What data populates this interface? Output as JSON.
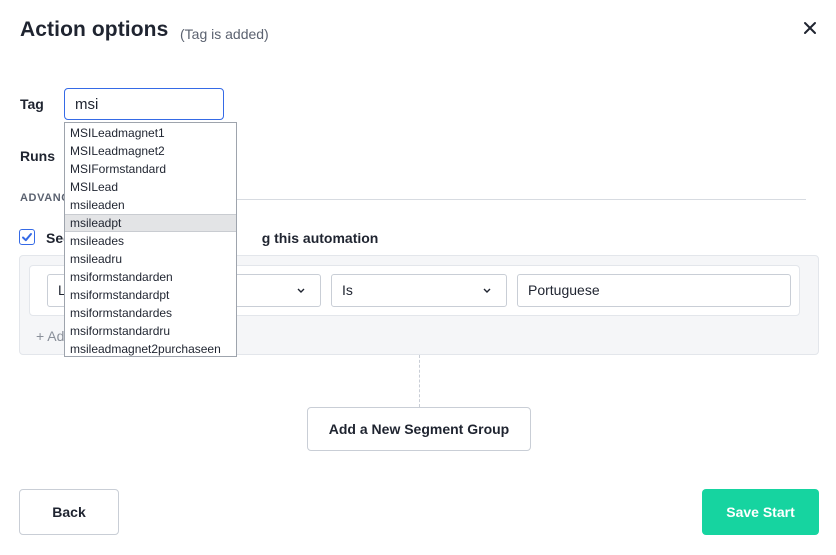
{
  "modal": {
    "title": "Action options",
    "subtitle": "(Tag is added)",
    "close_icon": "close-icon"
  },
  "tag": {
    "label": "Tag",
    "value": "msi"
  },
  "runs": {
    "label": "Runs"
  },
  "advanced": {
    "label": "ADVANC",
    "segment_checkbox_checked": true,
    "segment_label_start": "Seg",
    "segment_label_end": "g this automation"
  },
  "segment": {
    "field_value": "L",
    "operator_value": "Is",
    "condition_value": "Portuguese",
    "add_condition_label": "+ Ad"
  },
  "buttons": {
    "add_segment_group": "Add a New Segment Group",
    "back": "Back",
    "save_start": "Save Start"
  },
  "dropdown": {
    "highlighted_index": 5,
    "items": [
      "MSILeadmagnet1",
      "MSILeadmagnet2",
      "MSIFormstandard",
      "MSILead",
      "msileaden",
      "msileadpt",
      "msileades",
      "msileadru",
      "msiformstandarden",
      "msiformstandardpt",
      "msiformstandardes",
      "msiformstandardru",
      "msileadmagnet2purchaseen"
    ]
  },
  "colors": {
    "accent": "#356ae6",
    "save_button": "#16d4a0"
  }
}
